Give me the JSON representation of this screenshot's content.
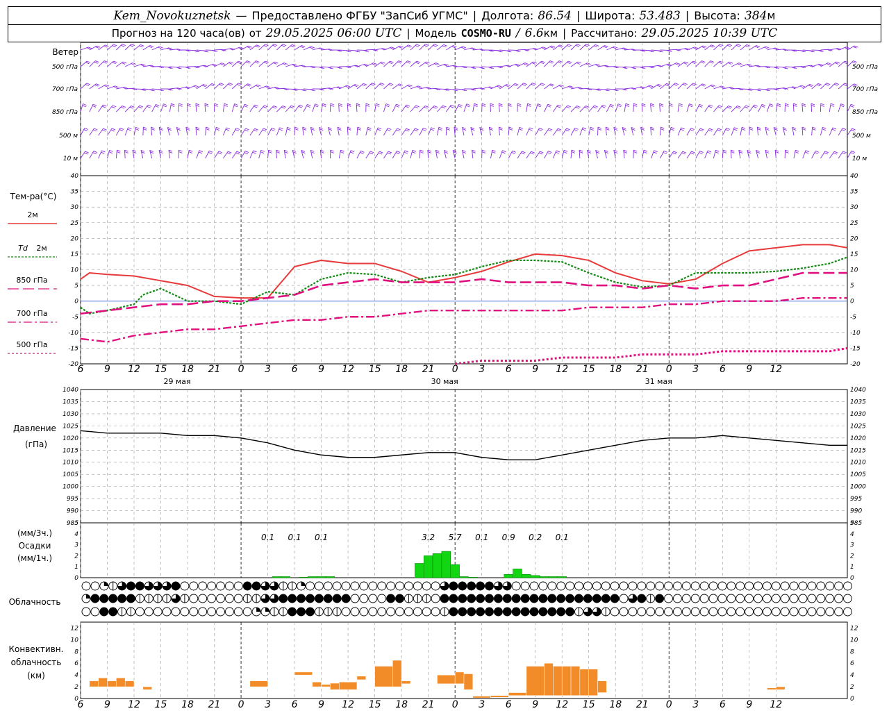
{
  "header": {
    "station": "Kem_Novokuznetsk",
    "dash": "—",
    "provider": "Предоставлено ФГБУ \"ЗапСиб УГМС\"",
    "lon_label": "Долгота:",
    "lon_value": "86.54",
    "lat_label": "Широта:",
    "lat_value": "53.483",
    "alt_label": "Высота:",
    "alt_value": "384",
    "alt_unit": "м",
    "sep": "|"
  },
  "subheader": {
    "forecast_label": "Прогноз на 120 часа(ов)",
    "from_label": "от",
    "from_value": "29.05.2025 06:00 UTC",
    "model_label": "Модель",
    "model_value": "COSMO-RU",
    "model_slash": "/",
    "model_res": "6.6",
    "model_res_unit": "км",
    "calc_label": "Рассчитано:",
    "calc_value": "29.05.2025 10:39 UTC",
    "sep": "|"
  },
  "time_axis": {
    "ticks": [
      "6",
      "9",
      "12",
      "15",
      "18",
      "21",
      "0",
      "3",
      "6",
      "9",
      "12",
      "15",
      "18",
      "21",
      "0",
      "3",
      "6",
      "9",
      "12",
      "15",
      "18",
      "21",
      "0",
      "3",
      "6",
      "9",
      "12"
    ],
    "dates": [
      "29 мая",
      "30 мая",
      "31 мая"
    ]
  },
  "wind_panel": {
    "title": "Ветер",
    "levels": [
      "500 гПа",
      "700 гПа",
      "850 гПа",
      "500 м",
      "10 м"
    ],
    "color": "#8a2be2"
  },
  "temp_panel": {
    "title": "Тем-ра(°С)",
    "legend": [
      {
        "label": "2м",
        "color": "#e83a3a"
      },
      {
        "label": "Td",
        "label2": "2м",
        "color": "#138a13"
      },
      {
        "label": "850 гПа",
        "color": "#e0117f"
      },
      {
        "label": "700 гПа",
        "color": "#e0117f"
      },
      {
        "label": "500 гПа",
        "color": "#e0117f"
      }
    ],
    "yticks": [
      "40",
      "35",
      "30",
      "25",
      "20",
      "15",
      "10",
      "5",
      "0",
      "-5",
      "-10",
      "-15",
      "-20"
    ]
  },
  "pressure_panel": {
    "title1": "Давление",
    "title2": "(гПа)",
    "yticks": [
      "1040",
      "1035",
      "1030",
      "1025",
      "1020",
      "1015",
      "1010",
      "1005",
      "1000",
      "995",
      "990",
      "985"
    ]
  },
  "precip_panel": {
    "title1": "(мм/3ч.)",
    "title2": "Осадки",
    "title3": "(мм/1ч.)",
    "yticks": [
      "5",
      "4",
      "3",
      "2",
      "1",
      "0"
    ],
    "color": "#11d611",
    "labels": [
      {
        "h": 21,
        "text": "0.1"
      },
      {
        "h": 24,
        "text": "0.1"
      },
      {
        "h": 27,
        "text": "0.1"
      },
      {
        "h": 39,
        "text": "3.2"
      },
      {
        "h": 42,
        "text": "5.7"
      },
      {
        "h": 45,
        "text": "0.1"
      },
      {
        "h": 48,
        "text": "0.9"
      },
      {
        "h": 51,
        "text": "0.2"
      },
      {
        "h": 54,
        "text": "0.1"
      }
    ]
  },
  "cloud_panel": {
    "title": "Облачность"
  },
  "conv_panel": {
    "title1": "Конвективн.",
    "title2": "облачность",
    "title3": "(км)",
    "yticks": [
      "12",
      "10",
      "8",
      "6",
      "4",
      "2",
      "0"
    ],
    "color": "#f28c28"
  },
  "chart_data": {
    "type": "line",
    "x_unit": "hours since 29.05.2025 06:00 UTC",
    "temperature": {
      "ylim": [
        -20,
        40
      ],
      "series": [
        {
          "name": "2м",
          "hours": [
            0,
            1,
            3,
            6,
            9,
            12,
            15,
            18,
            21,
            24,
            27,
            30,
            33,
            36,
            39,
            42,
            45,
            48,
            51,
            54,
            57,
            60,
            63,
            66,
            69,
            72,
            75,
            78,
            81,
            84,
            86
          ],
          "values": [
            7,
            9,
            8.5,
            8,
            6.5,
            5,
            1.5,
            1,
            1,
            11,
            13,
            12,
            12,
            9.5,
            6,
            7.5,
            9.5,
            12.5,
            15,
            14.5,
            13,
            9,
            6.5,
            5.5,
            7,
            12,
            16,
            17,
            18,
            18,
            17
          ]
        },
        {
          "name": "Td 2м",
          "hours": [
            0,
            1,
            3,
            6,
            7,
            9,
            12,
            15,
            18,
            21,
            24,
            27,
            30,
            33,
            36,
            39,
            42,
            45,
            48,
            51,
            54,
            57,
            60,
            63,
            66,
            69,
            72,
            75,
            78,
            81,
            84,
            86
          ],
          "values": [
            -2,
            -4,
            -3,
            -1,
            2,
            4,
            0,
            0,
            -1,
            3,
            2,
            7,
            9,
            8.5,
            6,
            7.5,
            8.5,
            11,
            13,
            13,
            12.5,
            9,
            6,
            4.5,
            5,
            9,
            9,
            9,
            9.5,
            10.5,
            12,
            14
          ]
        },
        {
          "name": "850 гПа",
          "hours": [
            0,
            3,
            6,
            9,
            12,
            15,
            18,
            21,
            24,
            27,
            30,
            33,
            36,
            39,
            42,
            45,
            48,
            51,
            54,
            57,
            60,
            63,
            66,
            69,
            72,
            75,
            78,
            81,
            84,
            86
          ],
          "values": [
            -4,
            -3,
            -2,
            -1,
            -1,
            0,
            0,
            1,
            2,
            5,
            6,
            7,
            6,
            6,
            6,
            7,
            6,
            6,
            6,
            5,
            5,
            4,
            5,
            4,
            5,
            5,
            7,
            9,
            9,
            9
          ]
        },
        {
          "name": "700 гПа",
          "hours": [
            0,
            3,
            6,
            9,
            12,
            15,
            18,
            21,
            24,
            27,
            30,
            33,
            36,
            39,
            42,
            45,
            48,
            51,
            54,
            57,
            60,
            63,
            66,
            69,
            72,
            75,
            78,
            81,
            84,
            86
          ],
          "values": [
            -12,
            -13,
            -11,
            -10,
            -9,
            -9,
            -8,
            -7,
            -6,
            -6,
            -5,
            -5,
            -4,
            -3,
            -3,
            -3,
            -3,
            -3,
            -3,
            -2,
            -2,
            -2,
            -1,
            -1,
            0,
            0,
            0,
            1,
            1,
            1
          ]
        },
        {
          "name": "500 гПа",
          "hours": [
            42,
            45,
            48,
            51,
            54,
            57,
            60,
            63,
            66,
            69,
            72,
            75,
            78,
            81,
            84,
            86
          ],
          "values": [
            -20,
            -19,
            -19,
            -19,
            -18,
            -18,
            -18,
            -17,
            -17,
            -17,
            -16,
            -16,
            -16,
            -16,
            -16,
            -15
          ]
        }
      ]
    },
    "pressure": {
      "ylim": [
        985,
        1040
      ],
      "hours": [
        0,
        3,
        6,
        9,
        12,
        15,
        18,
        21,
        24,
        27,
        30,
        33,
        36,
        39,
        42,
        45,
        48,
        51,
        54,
        57,
        60,
        63,
        66,
        69,
        72,
        75,
        78,
        81,
        84,
        86
      ],
      "values": [
        1023,
        1022,
        1022,
        1022,
        1021,
        1021,
        1020,
        1018,
        1015,
        1013,
        1012,
        1012,
        1013,
        1014,
        1014,
        1012,
        1011,
        1011,
        1013,
        1015,
        1017,
        1019,
        1020,
        1020,
        1021,
        1020,
        1019,
        1018,
        1017,
        1017
      ]
    },
    "precip_1h": {
      "ylim": [
        0,
        5
      ],
      "hours": [
        22,
        23,
        25,
        26,
        27,
        28,
        38,
        39,
        40,
        41,
        42,
        43,
        44,
        48,
        49,
        50,
        51,
        52,
        53,
        54
      ],
      "values": [
        0.1,
        0.1,
        0.05,
        0.1,
        0.1,
        0.1,
        1.3,
        2.0,
        2.2,
        2.4,
        1.2,
        0.1,
        0.05,
        0.3,
        0.8,
        0.3,
        0.2,
        0.1,
        0.1,
        0.1
      ]
    },
    "cloudiness": {
      "rows": [
        [
          0,
          0,
          1,
          2,
          3,
          4,
          4,
          3,
          3,
          3,
          4,
          0,
          0,
          0,
          0,
          0,
          0,
          0,
          4,
          4,
          3,
          3,
          2,
          2,
          1,
          0,
          0,
          0,
          0,
          0,
          0,
          0,
          0,
          0,
          0,
          0,
          0,
          0,
          0,
          0,
          3,
          4,
          4,
          4,
          4,
          4,
          3,
          3,
          0,
          0,
          0,
          0,
          0,
          0,
          0,
          0,
          0,
          0,
          0,
          0,
          0,
          0,
          0,
          0,
          0,
          0,
          0,
          0,
          0,
          0,
          0,
          0,
          0,
          0,
          0,
          0,
          0,
          0,
          0,
          0,
          0,
          0,
          0,
          0,
          0,
          0,
          0
        ],
        [
          1,
          4,
          4,
          4,
          4,
          4,
          2,
          2,
          2,
          2,
          3,
          2,
          0,
          0,
          0,
          0,
          0,
          0,
          2,
          2,
          3,
          3,
          4,
          4,
          4,
          4,
          4,
          4,
          4,
          4,
          0,
          0,
          0,
          0,
          4,
          4,
          2,
          2,
          2,
          0,
          4,
          4,
          4,
          4,
          4,
          4,
          4,
          4,
          4,
          4,
          4,
          4,
          4,
          4,
          4,
          4,
          4,
          4,
          4,
          4,
          0,
          3,
          4,
          2,
          4,
          0,
          0,
          0,
          0,
          0,
          0,
          0,
          0,
          0,
          0,
          0,
          0,
          0,
          0,
          0,
          0,
          0,
          0,
          0,
          0,
          0,
          0
        ],
        [
          0,
          0,
          4,
          4,
          2,
          2,
          0,
          0,
          0,
          0,
          0,
          0,
          0,
          0,
          0,
          0,
          0,
          0,
          0,
          1,
          1,
          2,
          2,
          4,
          4,
          4,
          2,
          2,
          2,
          0,
          0,
          0,
          0,
          0,
          0,
          0,
          0,
          0,
          0,
          0,
          2,
          4,
          4,
          4,
          4,
          4,
          4,
          4,
          4,
          4,
          4,
          4,
          4,
          4,
          4,
          2,
          3,
          3,
          2,
          0,
          0,
          0,
          0,
          0,
          0,
          0,
          0,
          0,
          0,
          0,
          0,
          0,
          0,
          0,
          0,
          0,
          0,
          0,
          0,
          0,
          0,
          0,
          0,
          0,
          0,
          0,
          0
        ]
      ]
    },
    "convective": {
      "ylim": [
        0,
        13
      ],
      "bars": [
        [
          1,
          2,
          2,
          3
        ],
        [
          2,
          3,
          2,
          3.5
        ],
        [
          3,
          4,
          2,
          3
        ],
        [
          4,
          5,
          2,
          3.5
        ],
        [
          5,
          6,
          2,
          3
        ],
        [
          7,
          8,
          1.5,
          2
        ],
        [
          19,
          21,
          2,
          3
        ],
        [
          24,
          26,
          4,
          4.5
        ],
        [
          26,
          27,
          2,
          2.8
        ],
        [
          27,
          28,
          2,
          2.4
        ],
        [
          28,
          29,
          1.5,
          2.6
        ],
        [
          29,
          31,
          1.5,
          2.8
        ],
        [
          31,
          32,
          3.2,
          3.8
        ],
        [
          33,
          35,
          2,
          5.5
        ],
        [
          35,
          36,
          2,
          6.5
        ],
        [
          36,
          37,
          2.5,
          3
        ],
        [
          40,
          42,
          2.5,
          4
        ],
        [
          42,
          43,
          2.5,
          4.5
        ],
        [
          43,
          44,
          1.5,
          4.2
        ],
        [
          44,
          46,
          0.1,
          0.4
        ],
        [
          46,
          48,
          0.2,
          0.5
        ],
        [
          48,
          50,
          0.5,
          1
        ],
        [
          50,
          52,
          0.5,
          5.5
        ],
        [
          52,
          53,
          0.5,
          6
        ],
        [
          53,
          54,
          0.5,
          5.5
        ],
        [
          54,
          55,
          0.5,
          5.5
        ],
        [
          55,
          56,
          0.5,
          5.5
        ],
        [
          56,
          57,
          0.5,
          5
        ],
        [
          57,
          58,
          0.5,
          5
        ],
        [
          58,
          59,
          1,
          3
        ],
        [
          77,
          78,
          1.5,
          1.8
        ],
        [
          78,
          79,
          1.5,
          2
        ]
      ]
    }
  }
}
